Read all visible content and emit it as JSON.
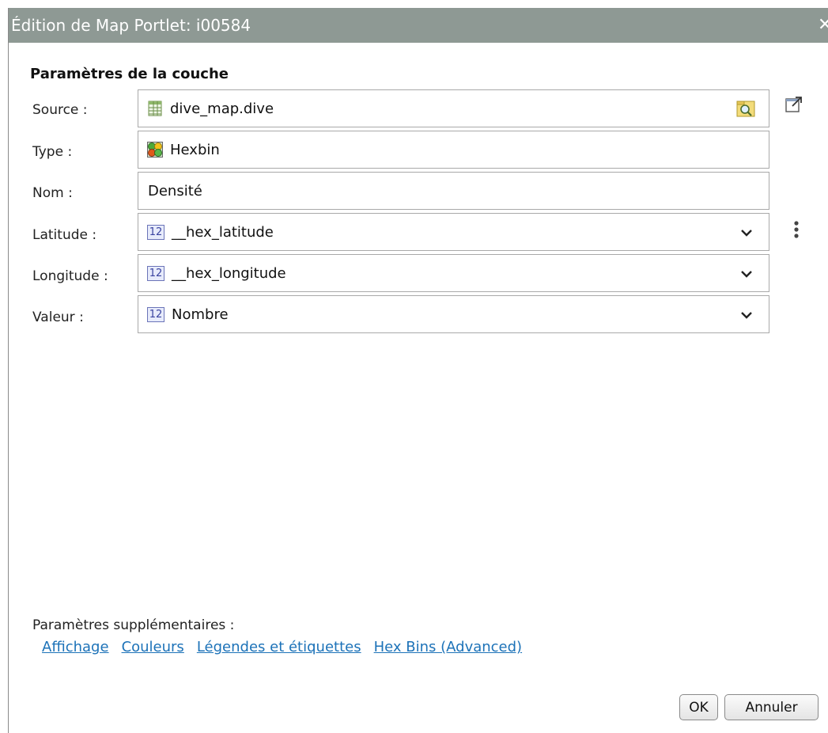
{
  "window": {
    "title": "Édition de Map Portlet: i00584",
    "close_glyph": "✕"
  },
  "section": {
    "title": "Paramètres de la couche"
  },
  "form": {
    "source": {
      "label": "Source :",
      "value": "dive_map.dive",
      "icon": "table-icon",
      "browse_icon": "folder-search-icon"
    },
    "type": {
      "label": "Type :",
      "value": "Hexbin",
      "icon": "hexbin-icon"
    },
    "name": {
      "label": "Nom :",
      "value": "Densité"
    },
    "latitude": {
      "label": "Latitude :",
      "value": "__hex_latitude",
      "icon": "numeric-12-icon",
      "icon_text": "12"
    },
    "longitude": {
      "label": "Longitude :",
      "value": "__hex_longitude",
      "icon": "numeric-12-icon",
      "icon_text": "12"
    },
    "value": {
      "label": "Valeur :",
      "value": "Nombre",
      "icon": "numeric-12-icon",
      "icon_text": "12"
    }
  },
  "side_icons": {
    "open_external": "open-external-icon",
    "more_options": "vertical-dots-icon"
  },
  "extra": {
    "label": "Paramètres supplémentaires :",
    "links": [
      "Affichage",
      "Couleurs",
      "Légendes et étiquettes",
      "Hex Bins (Advanced)"
    ]
  },
  "buttons": {
    "ok": "OK",
    "cancel": "Annuler"
  },
  "colors": {
    "titlebar": "#8e9994",
    "link": "#1c72b8"
  }
}
